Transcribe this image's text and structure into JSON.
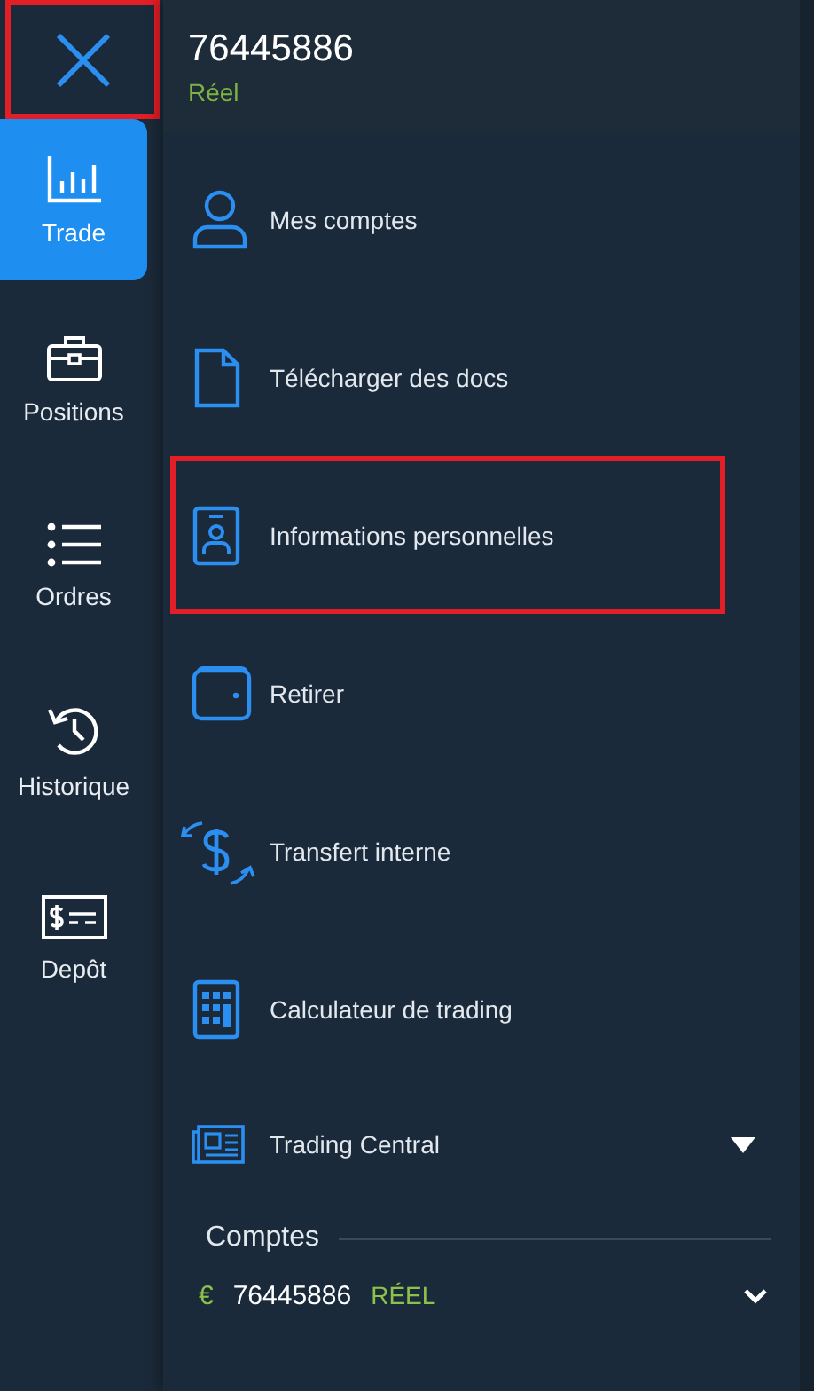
{
  "rail": {
    "close": {
      "highlighted": true
    },
    "items": [
      {
        "label": "Trade",
        "selected": true
      },
      {
        "label": "Positions",
        "selected": false
      },
      {
        "label": "Ordres",
        "selected": false
      },
      {
        "label": "Historique",
        "selected": false
      },
      {
        "label": "Depôt",
        "selected": false
      }
    ]
  },
  "account_header": {
    "number": "76445886",
    "type": "Réel"
  },
  "menu": [
    {
      "label": "Mes comptes",
      "kind": "link",
      "highlighted": false
    },
    {
      "label": "Télécharger des docs",
      "kind": "link",
      "highlighted": false
    },
    {
      "label": "Informations personnelles",
      "kind": "link",
      "highlighted": true
    },
    {
      "label": "Retirer",
      "kind": "link",
      "highlighted": false
    },
    {
      "label": "Transfert interne",
      "kind": "link",
      "highlighted": false
    },
    {
      "label": "Calculateur de trading",
      "kind": "link",
      "highlighted": false
    },
    {
      "label": "Trading Central",
      "kind": "expandable",
      "highlighted": false
    }
  ],
  "accounts": {
    "title": "Comptes",
    "rows": [
      {
        "currency": "€",
        "number": "76445886",
        "type": "RÉEL"
      }
    ]
  }
}
